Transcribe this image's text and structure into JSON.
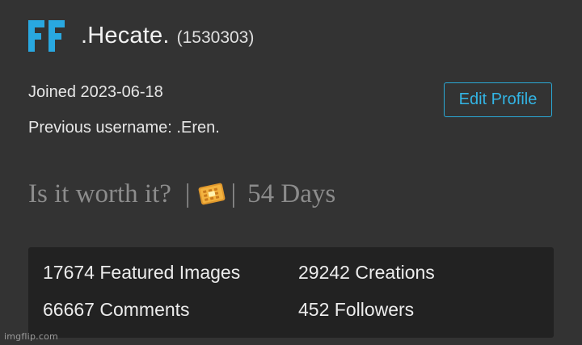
{
  "profile": {
    "avatar_icon": "ff-avatar-icon",
    "avatar_text": "FF",
    "avatar_color": "#29a8e0",
    "username": ".Hecate.",
    "user_id": "(1530303)",
    "joined": "Joined 2023-06-18",
    "previous_username": "Previous username: .Eren."
  },
  "actions": {
    "edit_profile_label": "Edit Profile",
    "accent_color": "#33b5e5"
  },
  "bio": {
    "text_before": "Is it worth it?",
    "separator_left": "|",
    "emoji_icon": "waffle-icon",
    "separator_right": "|",
    "text_after": "54 Days"
  },
  "stats": {
    "featured_images": "17674 Featured Images",
    "creations": "29242 Creations",
    "comments": "66667 Comments",
    "followers": "452 Followers"
  },
  "watermark": "imgflip.com"
}
